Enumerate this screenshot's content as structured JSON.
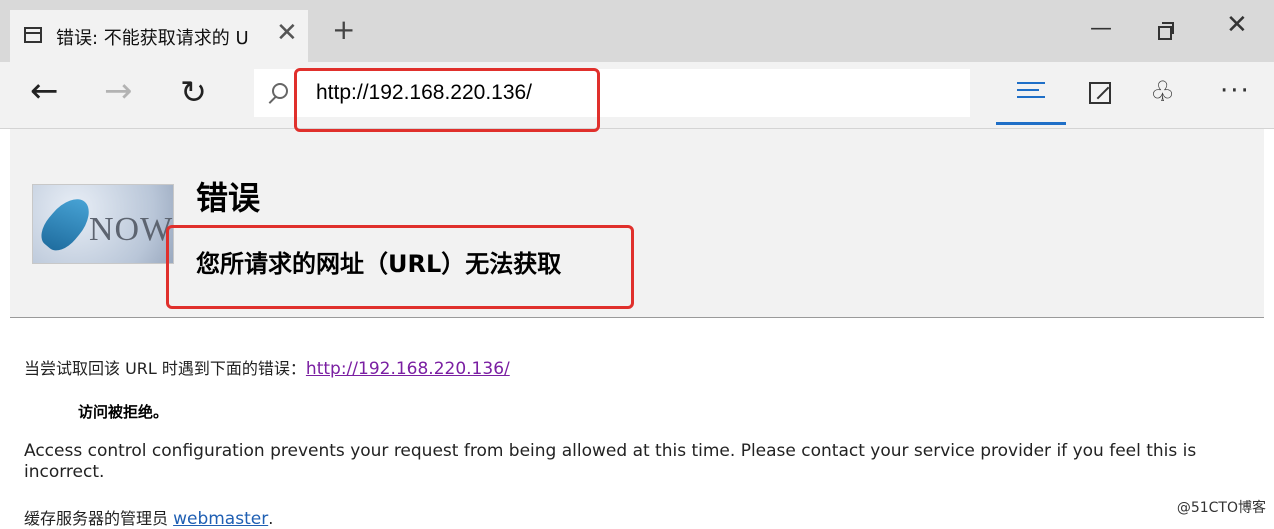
{
  "browser": {
    "tab": {
      "title": "错误: 不能获取请求的 U",
      "close_glyph": "✕"
    },
    "new_tab_glyph": "+",
    "window_controls": {
      "minimize": "—",
      "close": "✕"
    },
    "nav": {
      "back": "←",
      "forward": "→",
      "refresh": "↻"
    },
    "address_bar": {
      "url": "http://192.168.220.136/"
    },
    "toolbar_icons": [
      "hub-icon",
      "web-note-icon",
      "share-icon",
      "more-icon"
    ],
    "more_glyph": "···",
    "share_glyph": "♧"
  },
  "page": {
    "logo_text": "NOW",
    "title": "错误",
    "subtitle": "您所请求的网址（URL）无法获取",
    "intro_text": "当尝试取回该 URL 时遇到下面的错误：",
    "intro_link": "http://192.168.220.136/",
    "denied": "访问被拒绝。",
    "explanation": "Access control configuration prevents your request from being allowed at this time. Please contact your service provider if you feel this is incorrect.",
    "admin_text": "缓存服务器的管理员 ",
    "admin_link": "webmaster",
    "admin_suffix": "."
  },
  "watermark": "@51CTO博客",
  "colors": {
    "highlight": "#e0302c",
    "accent": "#1f6fc7",
    "visited_link": "#7a1fa2",
    "link": "#1f5fb3"
  }
}
